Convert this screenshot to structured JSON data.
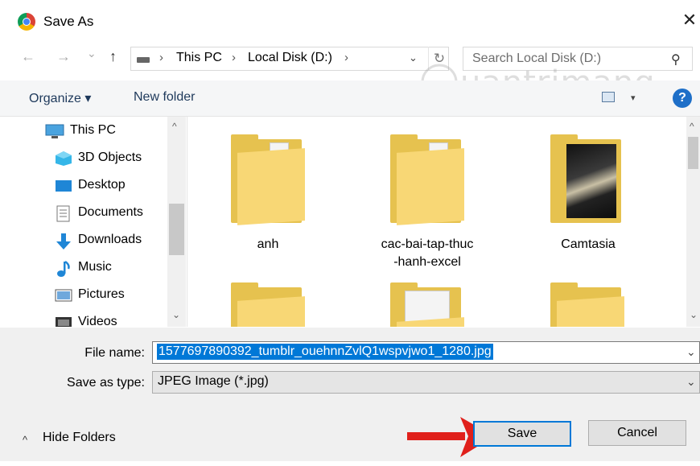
{
  "window": {
    "title": "Save As",
    "close_glyph": "✕"
  },
  "nav": {
    "back_glyph": "←",
    "forward_glyph": "→",
    "recent_glyph": "⌄",
    "up_glyph": "↑",
    "breadcrumb": [
      "This PC",
      "Local Disk (D:)"
    ],
    "sep_glyph": "›",
    "search_placeholder": "Search Local Disk (D:)",
    "search_glyph": "⚲",
    "refresh_glyph": "↻",
    "dropdown_glyph": "⌄"
  },
  "toolbar": {
    "organize_label": "Organize ▾",
    "new_folder_label": "New folder",
    "help_glyph": "?",
    "view_drop_glyph": "▾"
  },
  "watermark": {
    "text": "Quantrimang"
  },
  "sidebar": {
    "items": [
      {
        "label": "This PC",
        "icon": "pc-icon"
      },
      {
        "label": "3D Objects",
        "icon": "3d-objects-icon"
      },
      {
        "label": "Desktop",
        "icon": "desktop-icon"
      },
      {
        "label": "Documents",
        "icon": "documents-icon"
      },
      {
        "label": "Downloads",
        "icon": "downloads-icon"
      },
      {
        "label": "Music",
        "icon": "music-icon"
      },
      {
        "label": "Pictures",
        "icon": "pictures-icon"
      },
      {
        "label": "Videos",
        "icon": "videos-icon"
      }
    ],
    "scroll_up_glyph": "^",
    "scroll_down_glyph": "⌄"
  },
  "files": {
    "items": [
      {
        "name": "anh"
      },
      {
        "name": "cac-bai-tap-thuc\n-hanh-excel"
      },
      {
        "name": "Camtasia"
      }
    ]
  },
  "form": {
    "file_name_label": "File name:",
    "file_name_value": "1577697890392_tumblr_ouehnnZvlQ1wspvjwo1_1280.jpg",
    "save_type_label": "Save as type:",
    "save_type_value": "JPEG Image (*.jpg)",
    "dropdown_glyph": "⌄"
  },
  "footer": {
    "hide_folders_label": "Hide Folders",
    "hide_folders_glyph": "^",
    "save_label": "Save",
    "cancel_label": "Cancel"
  },
  "colors": {
    "accent": "#0078d7",
    "annotation_arrow": "#e0201b",
    "folder": "#f8d775"
  }
}
